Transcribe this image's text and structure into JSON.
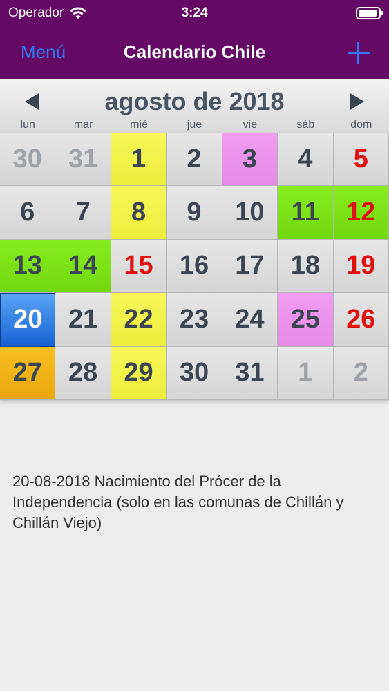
{
  "status_bar": {
    "carrier": "Operador",
    "time": "3:24"
  },
  "nav": {
    "menu_label": "Menú",
    "title": "Calendario Chile"
  },
  "calendar": {
    "month_title": "agosto de 2018",
    "weekdays": [
      "lun",
      "mar",
      "mié",
      "jue",
      "vie",
      "sáb",
      "dom"
    ],
    "days": [
      {
        "label": "30",
        "kind": "other"
      },
      {
        "label": "31",
        "kind": "other"
      },
      {
        "label": "1",
        "kind": "yellow"
      },
      {
        "label": "2",
        "kind": "normal"
      },
      {
        "label": "3",
        "kind": "pink"
      },
      {
        "label": "4",
        "kind": "normal"
      },
      {
        "label": "5",
        "kind": "sunday"
      },
      {
        "label": "6",
        "kind": "normal"
      },
      {
        "label": "7",
        "kind": "normal"
      },
      {
        "label": "8",
        "kind": "yellow"
      },
      {
        "label": "9",
        "kind": "normal"
      },
      {
        "label": "10",
        "kind": "normal"
      },
      {
        "label": "11",
        "kind": "green"
      },
      {
        "label": "12",
        "kind": "green-sunday"
      },
      {
        "label": "13",
        "kind": "green"
      },
      {
        "label": "14",
        "kind": "green"
      },
      {
        "label": "15",
        "kind": "holiday"
      },
      {
        "label": "16",
        "kind": "normal"
      },
      {
        "label": "17",
        "kind": "normal"
      },
      {
        "label": "18",
        "kind": "normal"
      },
      {
        "label": "19",
        "kind": "sunday"
      },
      {
        "label": "20",
        "kind": "selected"
      },
      {
        "label": "21",
        "kind": "normal"
      },
      {
        "label": "22",
        "kind": "yellow"
      },
      {
        "label": "23",
        "kind": "normal"
      },
      {
        "label": "24",
        "kind": "normal"
      },
      {
        "label": "25",
        "kind": "pink"
      },
      {
        "label": "26",
        "kind": "sunday"
      },
      {
        "label": "27",
        "kind": "orange"
      },
      {
        "label": "28",
        "kind": "normal"
      },
      {
        "label": "29",
        "kind": "yellow"
      },
      {
        "label": "30",
        "kind": "normal"
      },
      {
        "label": "31",
        "kind": "normal"
      },
      {
        "label": "1",
        "kind": "other"
      },
      {
        "label": "2",
        "kind": "other"
      }
    ]
  },
  "details": {
    "text": "20-08-2018 Nacimiento del Prócer de la Independencia (solo en las comunas de Chillán y Chillán Viejo)"
  }
}
